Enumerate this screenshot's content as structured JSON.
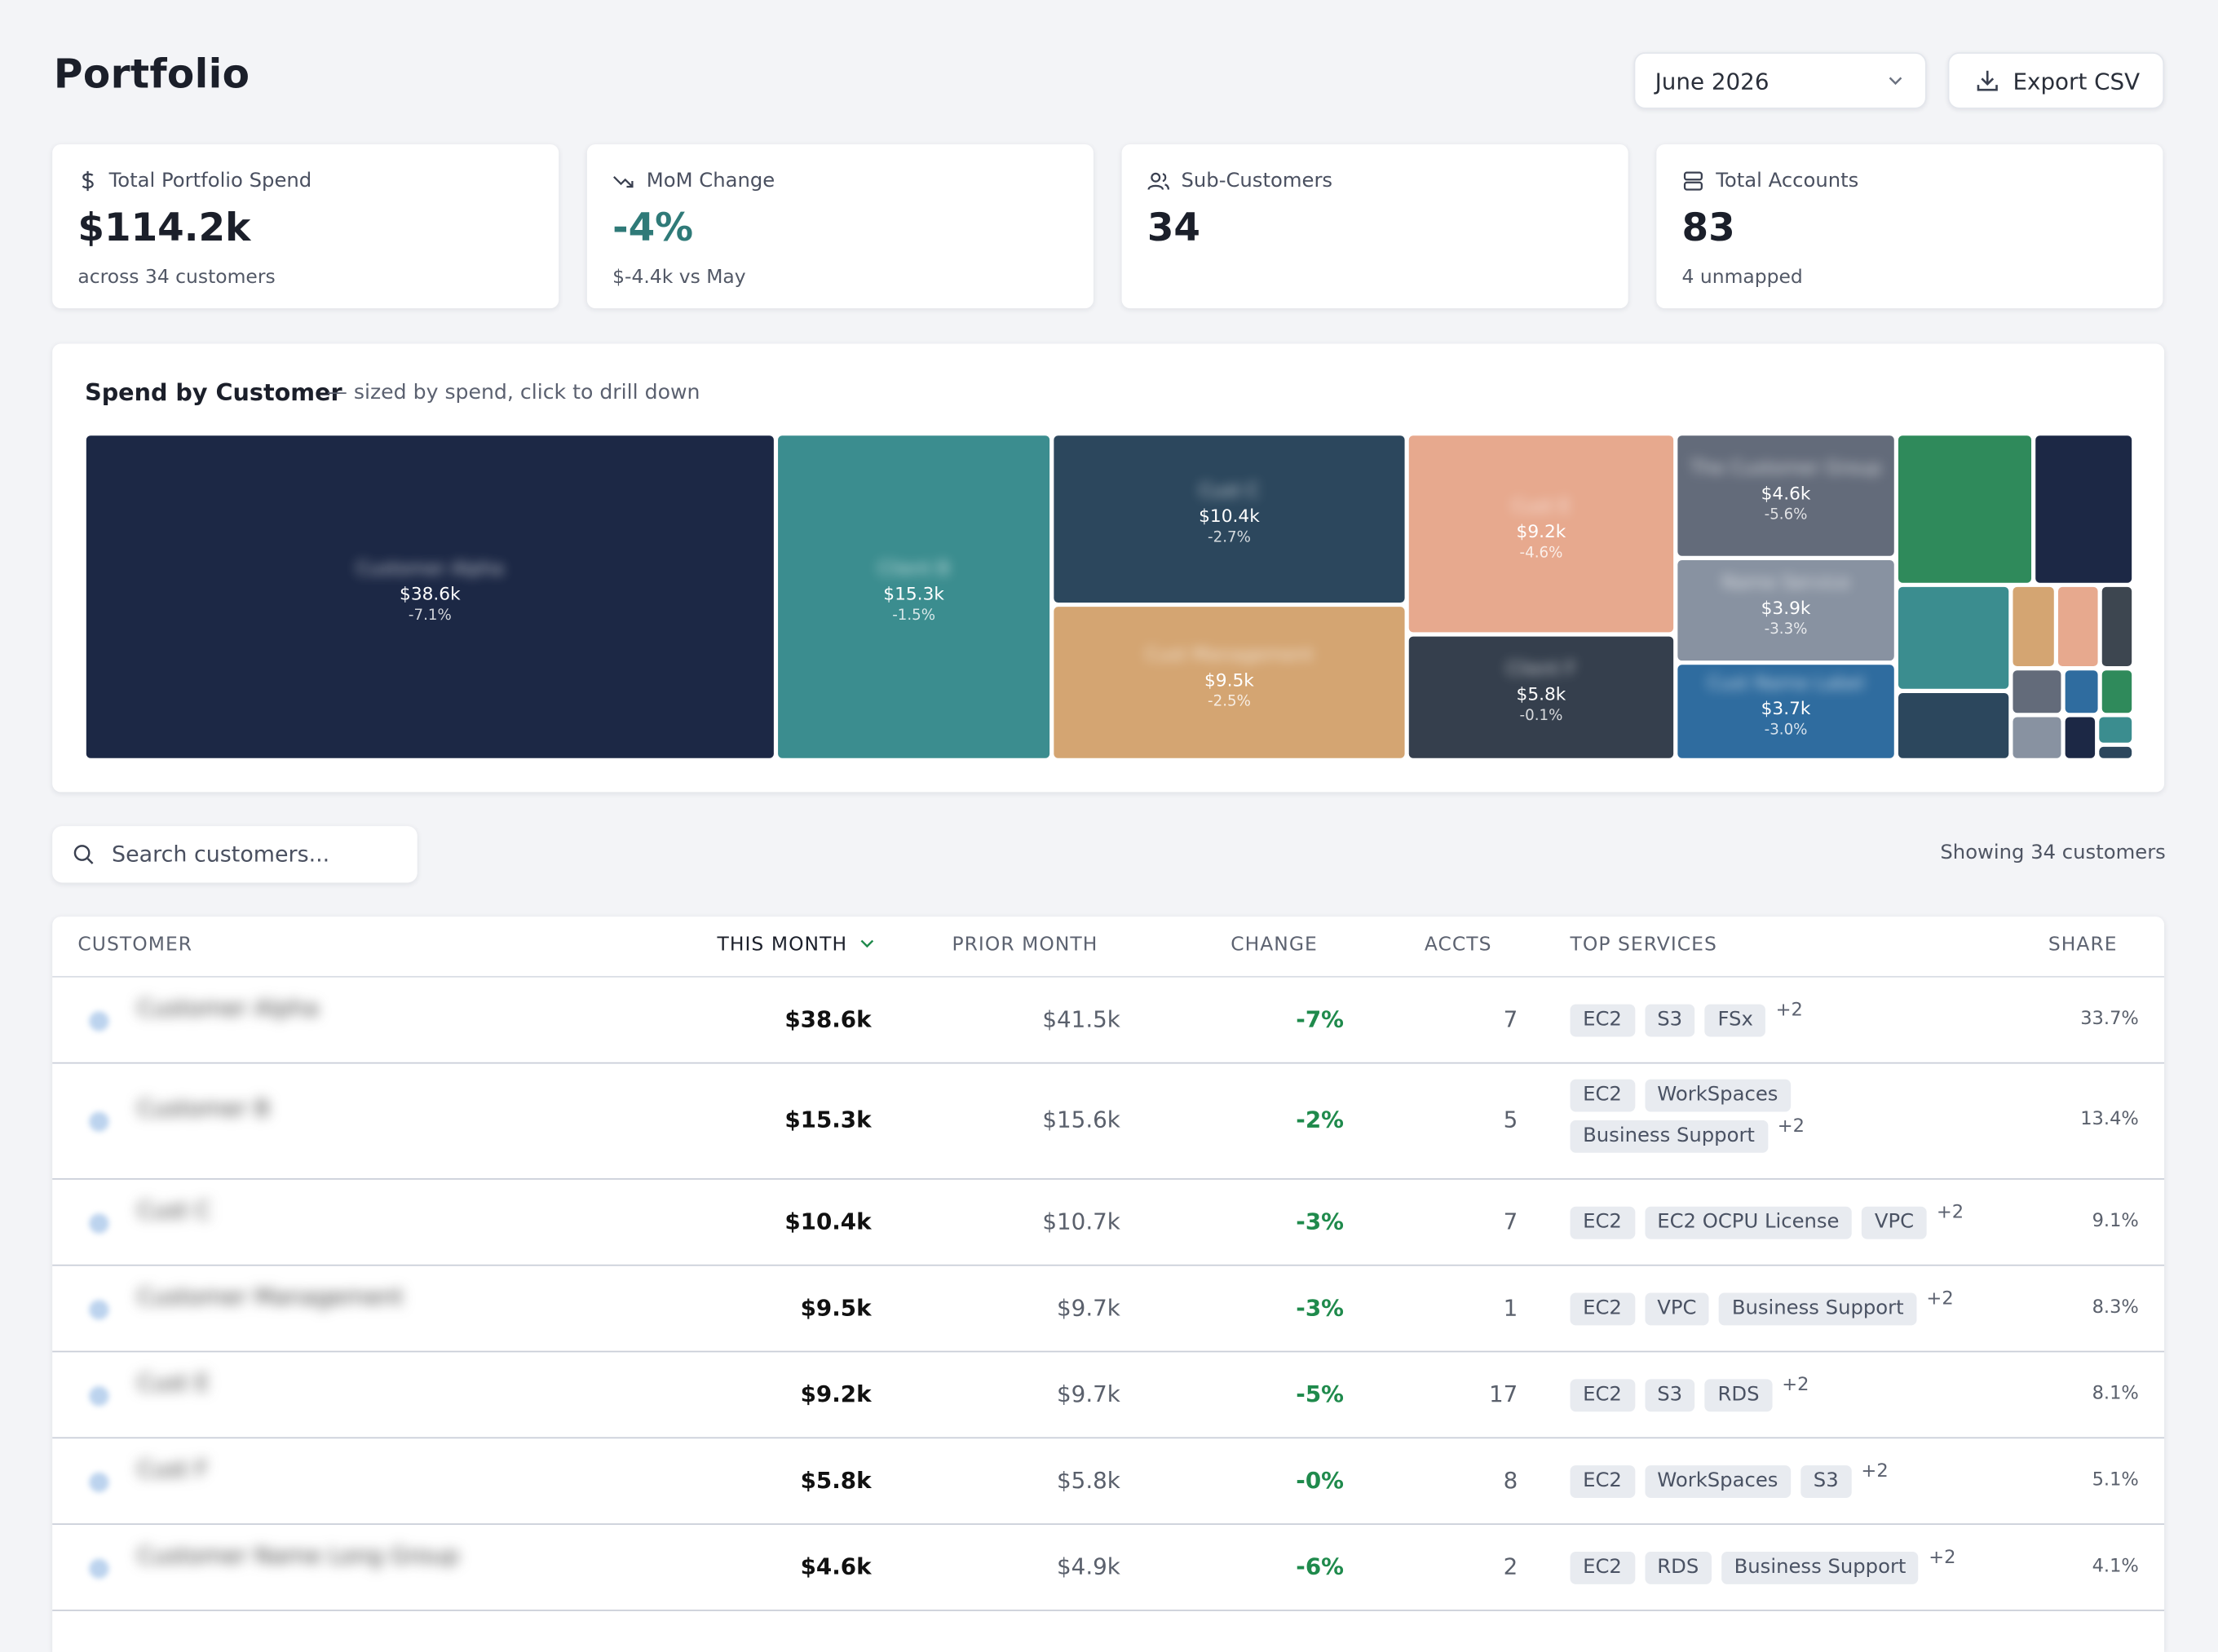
{
  "header": {
    "title": "Portfolio",
    "month_select": "June 2026",
    "export_label": "Export CSV"
  },
  "cards": [
    {
      "label": "Total Portfolio Spend",
      "value": "$114.2k",
      "sub": "across 34 customers",
      "icon": "dollar-icon"
    },
    {
      "label": "MoM Change",
      "value": "-4%",
      "sub": "$-4.4k vs May",
      "icon": "trend-down-icon"
    },
    {
      "label": "Sub-Customers",
      "value": "34",
      "sub": "",
      "icon": "users-icon"
    },
    {
      "label": "Total Accounts",
      "value": "83",
      "sub": "4 unmapped",
      "icon": "server-icon"
    }
  ],
  "treemap": {
    "title": "Spend by Customer",
    "hint": "— sized by spend, click to drill down",
    "tiles": [
      {
        "value": "$38.6k",
        "change": "-7.1%",
        "color": "#1c2845"
      },
      {
        "value": "$15.3k",
        "change": "-1.5%",
        "color": "#3b8d8f"
      },
      {
        "value": "$10.4k",
        "change": "-2.7%",
        "color": "#2c475d"
      },
      {
        "value": "$9.5k",
        "change": "-2.5%",
        "color": "#d4a572"
      },
      {
        "value": "$9.2k",
        "change": "-4.6%",
        "color": "#e7a98e"
      },
      {
        "value": "$5.8k",
        "change": "-0.1%",
        "color": "#353f4d"
      },
      {
        "value": "$4.6k",
        "change": "-5.6%",
        "color": "#636b7a"
      },
      {
        "value": "$3.9k",
        "change": "-3.3%",
        "color": "#8892a1"
      },
      {
        "value": "$3.7k",
        "change": "-3.0%",
        "color": "#2f6c9f"
      }
    ],
    "small_colors": [
      "#2f8a5b",
      "#1c2845",
      "#3b8d8f",
      "#d4a572",
      "#e7a98e",
      "#3d4650",
      "#2c475d",
      "#636b7a",
      "#2f6c9f",
      "#2f8a5b",
      "#8892a1",
      "#1c2845",
      "#3b8d8f",
      "#2c475d"
    ]
  },
  "search": {
    "placeholder": "Search customers..."
  },
  "showing": "Showing 34 customers",
  "table": {
    "headers": {
      "customer": "CUSTOMER",
      "this_month": "THIS MONTH",
      "prior_month": "PRIOR MONTH",
      "change": "CHANGE",
      "accts": "ACCTS",
      "top_services": "TOP SERVICES",
      "share": "SHARE"
    },
    "rows": [
      {
        "this_month": "$38.6k",
        "prior_month": "$41.5k",
        "change": "-7%",
        "accts": "7",
        "services": [
          "EC2",
          "S3",
          "FSx"
        ],
        "more": "+2",
        "share": "33.7%"
      },
      {
        "this_month": "$15.3k",
        "prior_month": "$15.6k",
        "change": "-2%",
        "accts": "5",
        "services": [
          "EC2",
          "WorkSpaces",
          "Business Support"
        ],
        "more": "+2",
        "share": "13.4%"
      },
      {
        "this_month": "$10.4k",
        "prior_month": "$10.7k",
        "change": "-3%",
        "accts": "7",
        "services": [
          "EC2",
          "EC2 OCPU License",
          "VPC"
        ],
        "more": "+2",
        "share": "9.1%"
      },
      {
        "this_month": "$9.5k",
        "prior_month": "$9.7k",
        "change": "-3%",
        "accts": "1",
        "services": [
          "EC2",
          "VPC",
          "Business Support"
        ],
        "more": "+2",
        "share": "8.3%"
      },
      {
        "this_month": "$9.2k",
        "prior_month": "$9.7k",
        "change": "-5%",
        "accts": "17",
        "services": [
          "EC2",
          "S3",
          "RDS"
        ],
        "more": "+2",
        "share": "8.1%"
      },
      {
        "this_month": "$5.8k",
        "prior_month": "$5.8k",
        "change": "-0%",
        "accts": "8",
        "services": [
          "EC2",
          "WorkSpaces",
          "S3"
        ],
        "more": "+2",
        "share": "5.1%"
      },
      {
        "this_month": "$4.6k",
        "prior_month": "$4.9k",
        "change": "-6%",
        "accts": "2",
        "services": [
          "EC2",
          "RDS",
          "Business Support"
        ],
        "more": "+2",
        "share": "4.1%"
      }
    ]
  }
}
